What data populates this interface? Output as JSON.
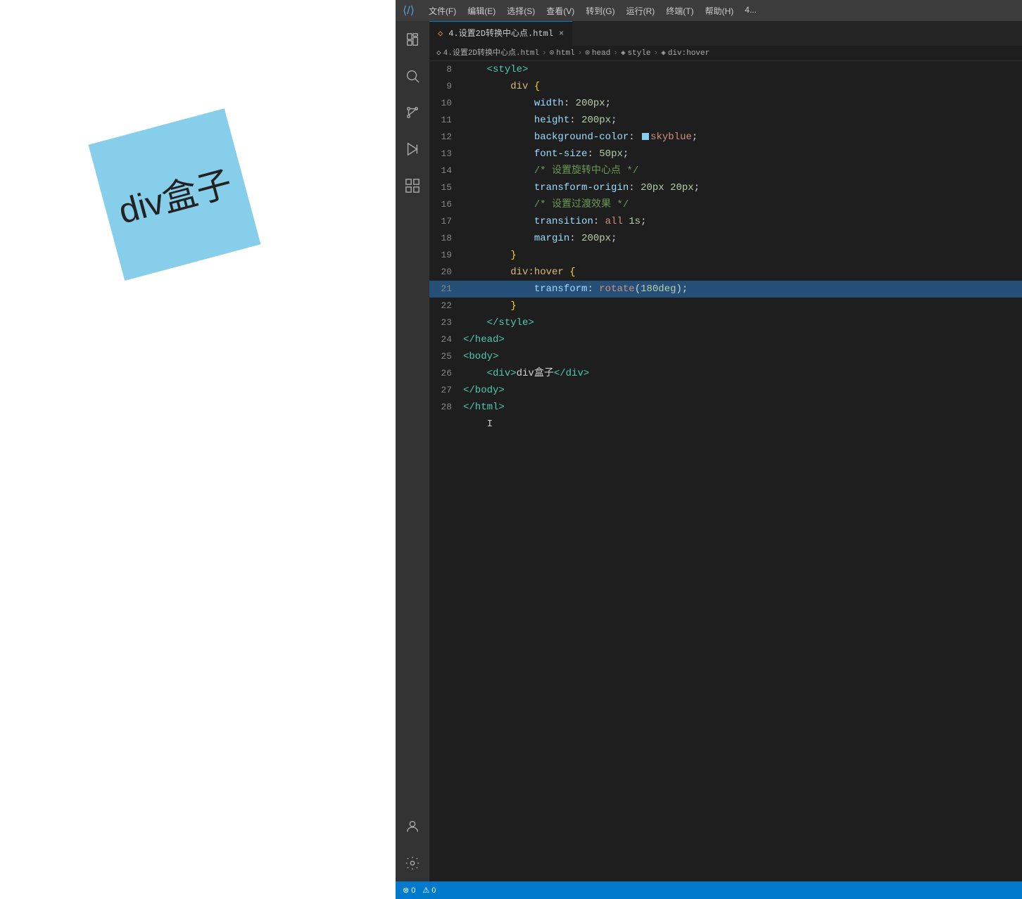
{
  "preview": {
    "div_text": "div盒子",
    "background": "#ffffff"
  },
  "titlebar": {
    "icon": "⟨⟩",
    "menu_items": [
      "文件(F)",
      "编辑(E)",
      "选择(S)",
      "查看(V)",
      "转到(G)",
      "运行(R)",
      "终端(T)",
      "帮助(H)",
      "4..."
    ]
  },
  "tab": {
    "icon": "◇",
    "filename": "4.设置2D转换中心点.html",
    "close": "×"
  },
  "breadcrumb": {
    "items": [
      "4.设置2D转换中心点.html",
      "html",
      "head",
      "style",
      "div:hover"
    ]
  },
  "code_lines": [
    {
      "num": 8,
      "content": "    <style>",
      "type": "tag"
    },
    {
      "num": 9,
      "content": "        div {",
      "type": "selector"
    },
    {
      "num": 10,
      "content": "            width: 200px;",
      "type": "property"
    },
    {
      "num": 11,
      "content": "            height: 200px;",
      "type": "property"
    },
    {
      "num": 12,
      "content": "            background-color: skyblue;",
      "type": "property-color"
    },
    {
      "num": 13,
      "content": "            font-size: 50px;",
      "type": "property"
    },
    {
      "num": 14,
      "content": "            /* 设置旋转中心点 */",
      "type": "comment"
    },
    {
      "num": 15,
      "content": "            transform-origin: 20px 20px;",
      "type": "property"
    },
    {
      "num": 16,
      "content": "            /* 设置过渡效果 */",
      "type": "comment"
    },
    {
      "num": 17,
      "content": "            transition: all 1s;",
      "type": "property"
    },
    {
      "num": 18,
      "content": "            margin: 200px;",
      "type": "property"
    },
    {
      "num": 19,
      "content": "        }",
      "type": "bracket"
    },
    {
      "num": 20,
      "content": "        div:hover {",
      "type": "selector"
    },
    {
      "num": 21,
      "content": "            transform: rotate(180deg);",
      "type": "property",
      "active": true
    },
    {
      "num": 22,
      "content": "        }",
      "type": "bracket"
    },
    {
      "num": 23,
      "content": "    </style>",
      "type": "tag"
    },
    {
      "num": 24,
      "content": "</head>",
      "type": "tag"
    },
    {
      "num": 25,
      "content": "<body>",
      "type": "tag"
    },
    {
      "num": 26,
      "content": "    <div>div盒子</div>",
      "type": "content"
    },
    {
      "num": 27,
      "content": "</body>",
      "type": "tag"
    },
    {
      "num": 28,
      "content": "</html>",
      "type": "tag"
    }
  ],
  "statusbar": {
    "errors": "0",
    "warnings": "0"
  },
  "activity_icons": {
    "explorer": "⧉",
    "search": "🔍",
    "source_control": "⑂",
    "run": "▷",
    "extensions": "⊞",
    "account": "👤",
    "settings": "⚙"
  }
}
